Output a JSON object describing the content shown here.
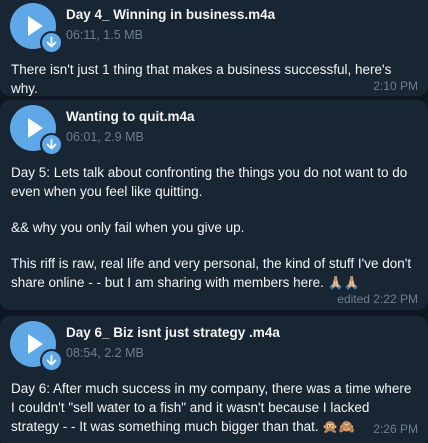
{
  "messages": [
    {
      "file_name": "Day 4_ Winning in business.m4a",
      "file_meta": "06:11, 1.5 MB",
      "paragraphs": [
        "There isn't just 1 thing that makes a business successful, here's why."
      ],
      "time": "2:10 PM"
    },
    {
      "file_name": "Wanting to quit.m4a",
      "file_meta": "06:01, 2.9 MB",
      "paragraphs": [
        "Day 5: Lets talk about confronting the things you do not want to do even when you feel like quitting.",
        "&&  why you only fail when you give up.",
        "This riff is raw, real life and very personal, the kind of stuff I've don't share online - - but I am sharing with members here."
      ],
      "emoji": "🙏🏼🙏🏼",
      "time": "edited 2:22 PM"
    },
    {
      "file_name": "Day 6_ Biz isnt just strategy .m4a",
      "file_meta": "08:54, 2.2 MB",
      "paragraphs": [
        "Day 6: After much success in my company, there was a time where I couldn't \"sell water to a fish\" and it wasn't because I lacked strategy - - It was something much bigger than that."
      ],
      "emoji": "🙊🙈",
      "time": "2:26 PM"
    }
  ],
  "icons": {
    "play": "play-icon",
    "download": "download-arrow-icon"
  },
  "colors": {
    "background": "#0e1621",
    "bubble": "#182533",
    "accent": "#5fa8e8",
    "meta_text": "#6d7f8f",
    "text": "#f5f5f5"
  }
}
